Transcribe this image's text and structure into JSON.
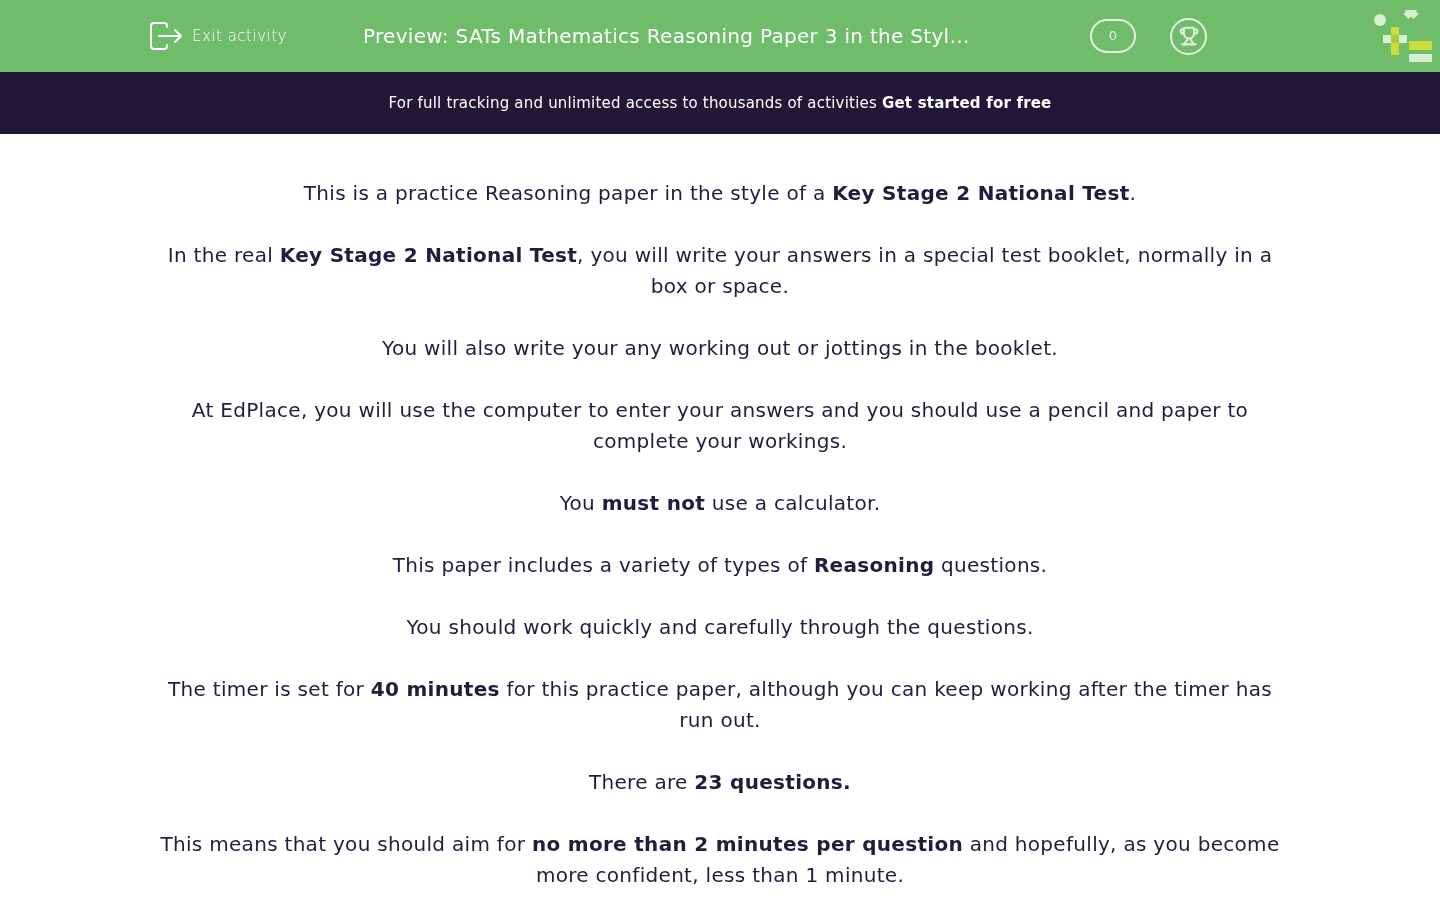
{
  "header": {
    "exit_button": "Exit activity",
    "title": "Preview: SATs Mathematics Reasoning Paper 3 in the Styl…",
    "score": "0"
  },
  "banner": {
    "text": "For full tracking and unlimited access to thousands of activities",
    "link": "Get started for free"
  },
  "intro_paragraphs": [
    "This is a practice Reasoning paper in the style of a **Key Stage 2 National Test**.",
    "In the real **Key Stage 2 National Test**, you will write your answers in a special test booklet, normally in a box or space.",
    "You will also write your any working out or jottings in the booklet.",
    "At EdPlace, you will use the computer to enter your answers and you should use a pencil and paper to complete your workings.",
    "You **must not** use a calculator.",
    "This paper includes a variety of types of **Reasoning** questions.",
    "You should work quickly and carefully through the questions.",
    "The timer is set for **40 minutes** for this practice paper, although you can keep working after the timer has run out.",
    "There are **23 questions.**",
    "This means that you should aim for **no more than 2 minutes per question** and hopefully, as you become more confident, less than 1 minute."
  ]
}
